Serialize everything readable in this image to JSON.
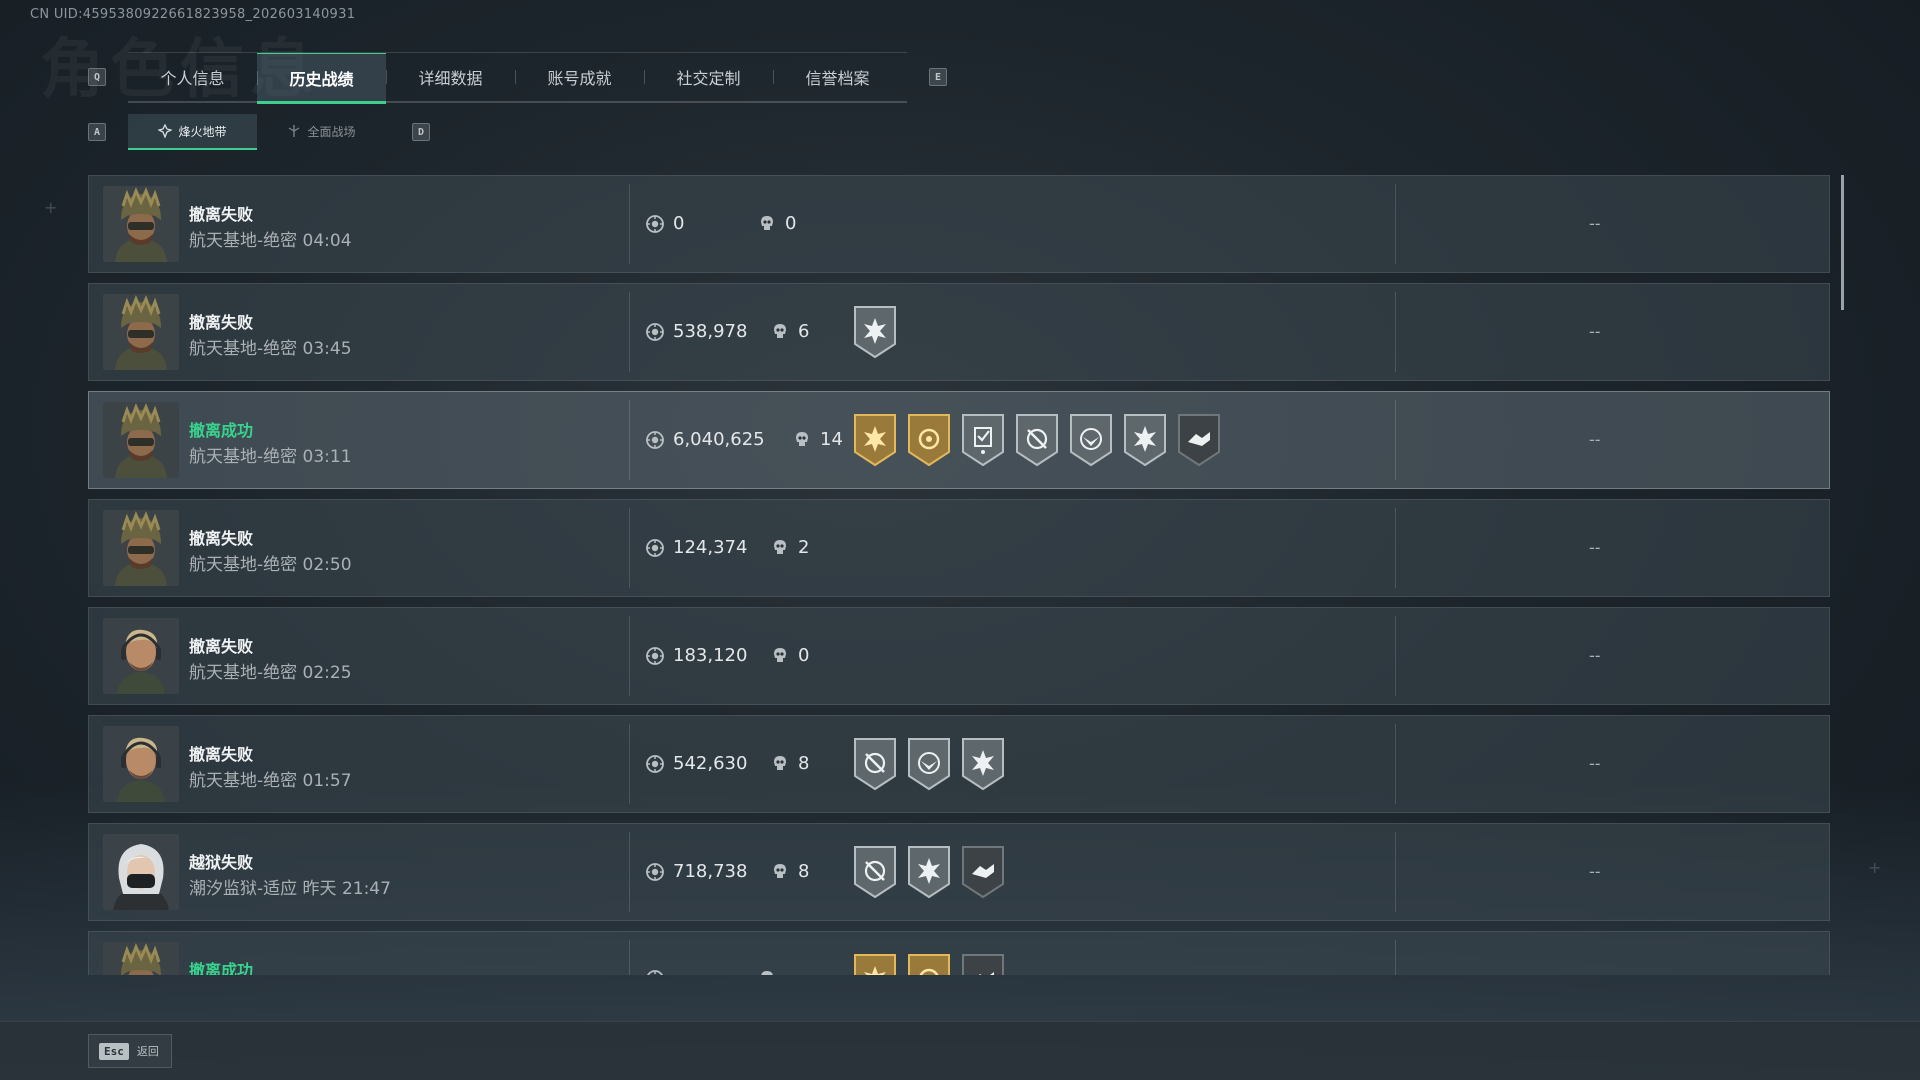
{
  "uid": "CN UID:4595380922661823958_202603140931",
  "background_title": "角色信息",
  "keys": {
    "prev_tab": "Q",
    "next_tab": "E",
    "prev_sub": "A",
    "next_sub": "D"
  },
  "tabs": [
    {
      "label": "个人信息",
      "active": false
    },
    {
      "label": "历史战绩",
      "active": true
    },
    {
      "label": "详细数据",
      "active": false
    },
    {
      "label": "账号成就",
      "active": false
    },
    {
      "label": "社交定制",
      "active": false
    },
    {
      "label": "信誉档案",
      "active": false
    }
  ],
  "subtabs": [
    {
      "label": "烽火地带",
      "active": true
    },
    {
      "label": "全面战场",
      "active": false
    }
  ],
  "accent_color": "#3ecf8e",
  "matches": [
    {
      "result": "撤离失败",
      "success": false,
      "map": "航天基地-绝密",
      "time": "04:04",
      "value": "0",
      "kills": "0",
      "avatar": "helmet-soldier",
      "medals": [],
      "extra": "--"
    },
    {
      "result": "撤离失败",
      "success": false,
      "map": "航天基地-绝密",
      "time": "03:45",
      "value": "538,978",
      "kills": "6",
      "avatar": "helmet-soldier",
      "medals": [
        "silver-star-burst"
      ],
      "extra": "--"
    },
    {
      "result": "撤离成功",
      "success": true,
      "map": "航天基地-绝密",
      "time": "03:11",
      "value": "6,040,625",
      "kills": "14",
      "avatar": "helmet-soldier",
      "medals": [
        "gold-star-burst",
        "gold-crosshair",
        "silver-checklist",
        "silver-no-scope",
        "silver-eagle-target",
        "silver-star-burst",
        "dark-handshake"
      ],
      "extra": "--",
      "highlight": true
    },
    {
      "result": "撤离失败",
      "success": false,
      "map": "航天基地-绝密",
      "time": "02:50",
      "value": "124,374",
      "kills": "2",
      "avatar": "helmet-soldier",
      "medals": [],
      "extra": "--"
    },
    {
      "result": "撤离失败",
      "success": false,
      "map": "航天基地-绝密",
      "time": "02:25",
      "value": "183,120",
      "kills": "0",
      "avatar": "headset-soldier",
      "medals": [],
      "extra": "--"
    },
    {
      "result": "撤离失败",
      "success": false,
      "map": "航天基地-绝密",
      "time": "01:57",
      "value": "542,630",
      "kills": "8",
      "avatar": "headset-soldier",
      "medals": [
        "silver-no-scope",
        "silver-eagle-target",
        "silver-star-burst"
      ],
      "extra": "--"
    },
    {
      "result": "越狱失败",
      "success": false,
      "map": "潮汐监狱-适应",
      "time": "昨天 21:47",
      "value": "718,738",
      "kills": "8",
      "avatar": "masked-woman",
      "medals": [
        "silver-no-scope",
        "silver-star-burst",
        "dark-handshake"
      ],
      "extra": "--"
    },
    {
      "result": "撤离成功",
      "success": true,
      "map": "",
      "time": "",
      "value": "",
      "kills": "",
      "avatar": "helmet-soldier",
      "medals": [
        "gold-star-burst",
        "gold-crosshair",
        "dark-handshake"
      ],
      "extra": ""
    }
  ],
  "footer": {
    "esc_key": "Esc",
    "back_label": "返回"
  }
}
